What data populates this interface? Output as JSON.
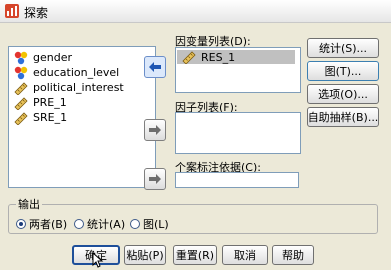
{
  "window": {
    "title": "探索"
  },
  "variables": [
    {
      "name": "gender",
      "icon": "nominal-icon"
    },
    {
      "name": "education_level",
      "icon": "nominal-icon"
    },
    {
      "name": "political_interest",
      "icon": "scale-ruler-icon"
    },
    {
      "name": "PRE_1",
      "icon": "scale-ruler-icon"
    },
    {
      "name": "SRE_1",
      "icon": "scale-ruler-icon"
    }
  ],
  "dependent": {
    "label": "因变量列表(D):",
    "items": [
      "RES_1"
    ]
  },
  "factor": {
    "label": "因子列表(F):"
  },
  "case_label": {
    "label": "个案标注依据(C):",
    "value": ""
  },
  "side_buttons": [
    "统计(S)...",
    "图(T)...",
    "选项(O)...",
    "自助抽样(B)..."
  ],
  "display": {
    "title": "输出",
    "options": [
      "两者(B)",
      "统计(A)",
      "图(L)"
    ],
    "selected": "两者(B)"
  },
  "bottom_buttons": [
    "确定",
    "粘贴(P)",
    "重置(R)",
    "取消",
    "帮助"
  ]
}
